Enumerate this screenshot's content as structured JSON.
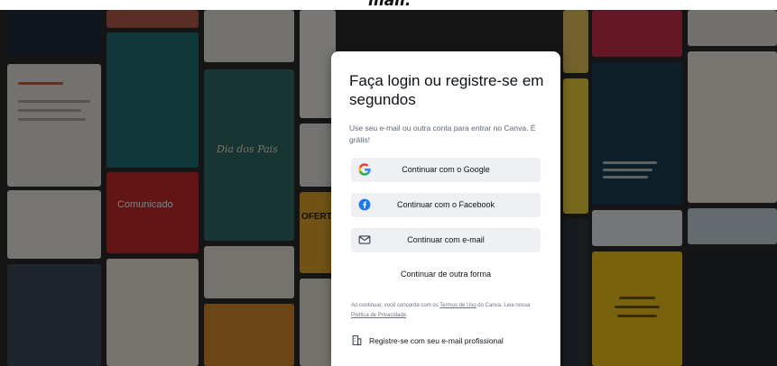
{
  "caption": "mail.",
  "login": {
    "title": "Faça login ou registre-se em segundos",
    "subtitle": "Use seu e-mail ou outra conta para entrar no Canva. É grátis!",
    "buttons": {
      "google": "Continuar com o Google",
      "facebook": "Continuar com o Facebook",
      "email": "Continuar com e-mail",
      "other": "Continuar de outra forma"
    },
    "terms": {
      "prefix": "Ao continuar, você concorda com os ",
      "terms_link": "Termos de Uso",
      "middle": " do Canva. Leia nossa ",
      "privacy_link": "Política de Privacidade",
      "suffix": "."
    },
    "work_email": "Registre-se com seu e-mail profissional"
  },
  "background": {
    "tile_texts": {
      "dia_pais": "Dia dos Pais",
      "comunicado": "Comunicado",
      "oferta": "OFERTA"
    }
  },
  "colors": {
    "google_red": "#ea4335",
    "google_blue": "#4285f4",
    "google_yellow": "#fbbc05",
    "google_green": "#34a853",
    "facebook_blue": "#1877f2",
    "button_bg": "#eef0f3",
    "text": "#0e1318"
  },
  "icons": {
    "google": "google-logo-icon",
    "facebook": "facebook-logo-icon",
    "email": "mail-icon",
    "work": "building-icon"
  }
}
